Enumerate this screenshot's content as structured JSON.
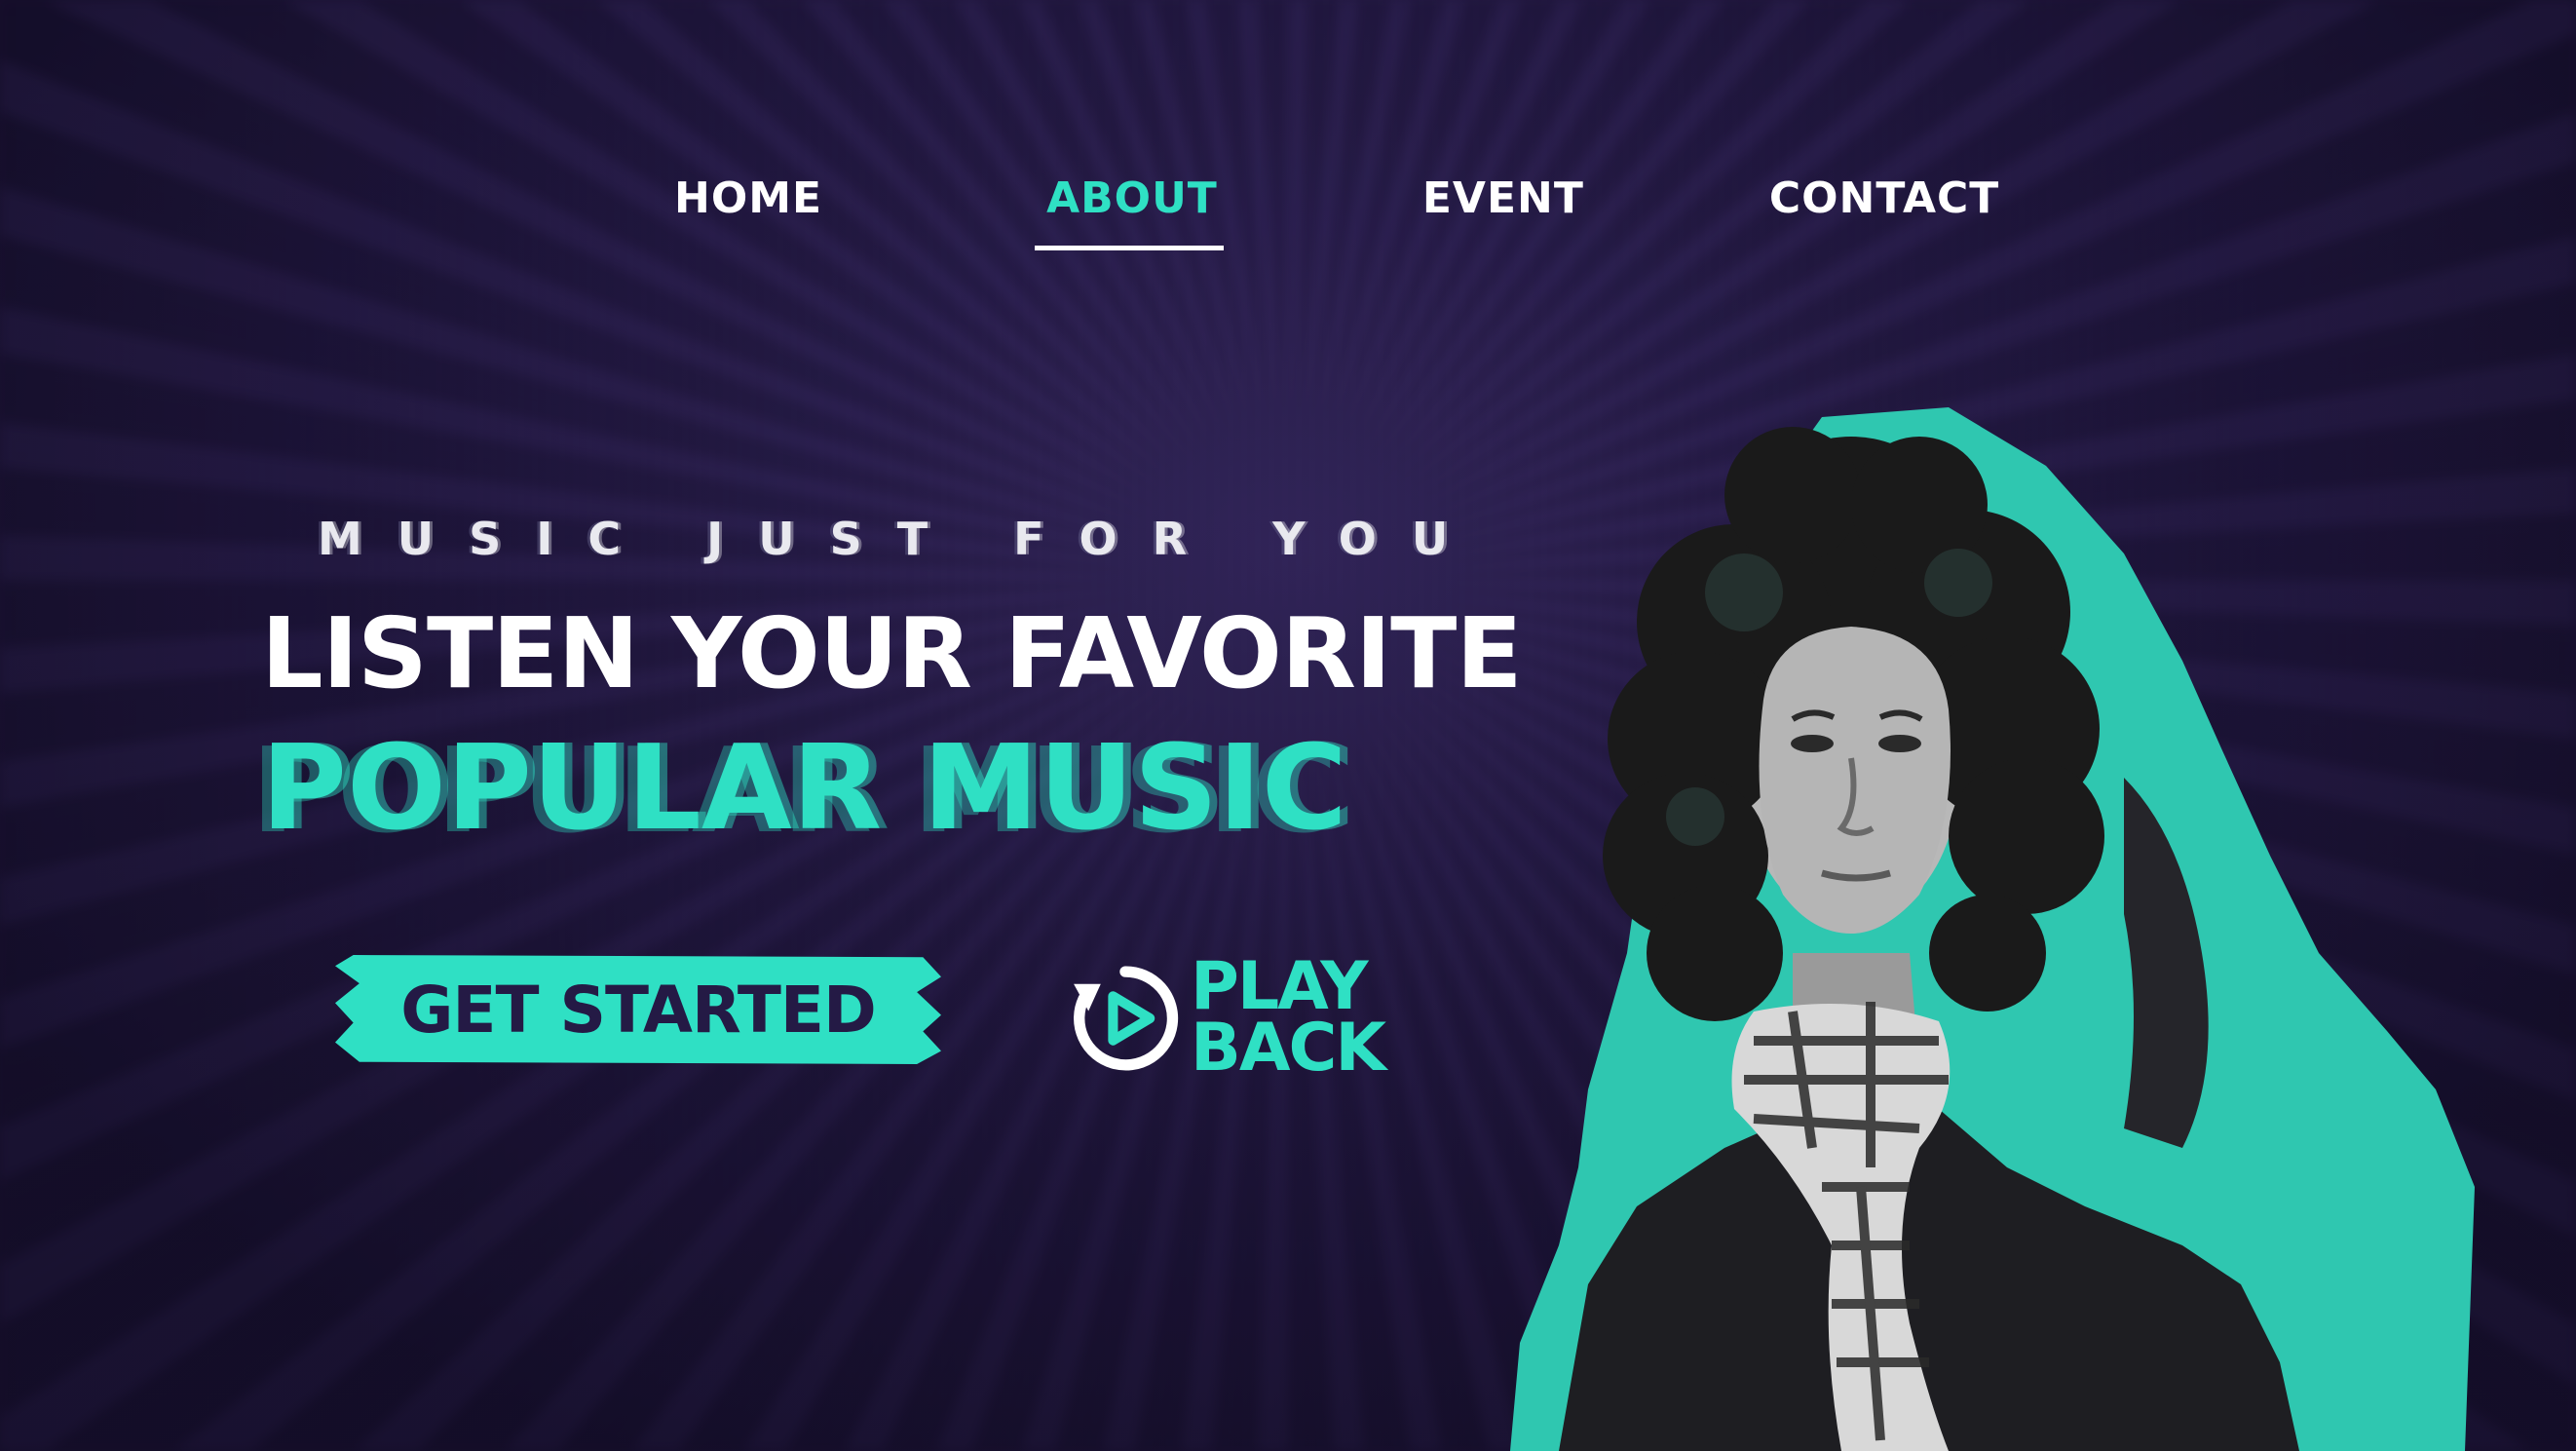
{
  "nav": {
    "items": [
      {
        "label": "HOME",
        "active": false
      },
      {
        "label": "ABOUT",
        "active": true
      },
      {
        "label": "EVENT",
        "active": false
      },
      {
        "label": "CONTACT",
        "active": false
      }
    ]
  },
  "hero": {
    "tagline": "MUSIC JUST FOR YOU",
    "headline": "LISTEN YOUR FAVORITE",
    "headline_accent": "POPULAR MUSIC",
    "cta_label": "GET STARTED",
    "playback": {
      "line1": "PLAY",
      "line2": "BACK",
      "icon": "replay-play-icon"
    }
  },
  "colors": {
    "accent": "#2fe0c4",
    "background": "#1d1438",
    "text": "#ffffff",
    "button_text": "#241a45"
  }
}
